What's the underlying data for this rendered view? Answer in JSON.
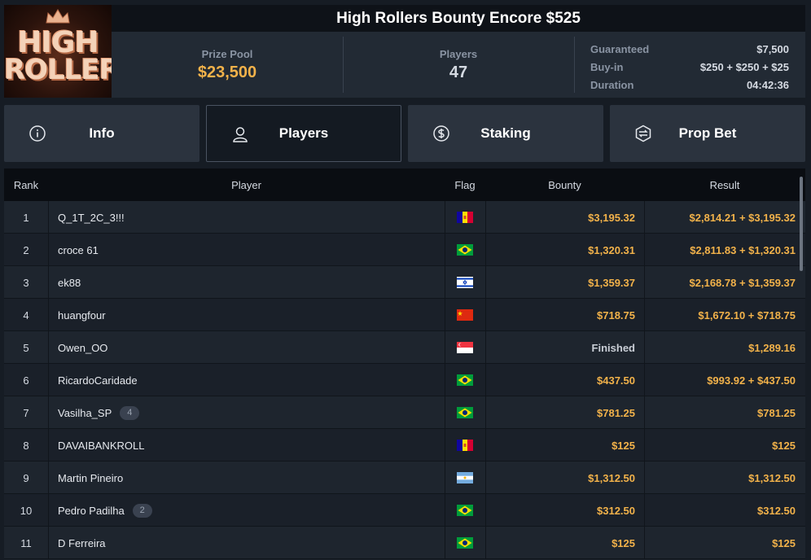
{
  "logo": {
    "line1": "HIGH",
    "line2": "ROLLERS"
  },
  "header": {
    "title": "High Rollers Bounty Encore $525"
  },
  "stats": {
    "prize_pool_label": "Prize Pool",
    "prize_pool_value": "$23,500",
    "players_label": "Players",
    "players_value": "47",
    "guaranteed_label": "Guaranteed",
    "guaranteed_value": "$7,500",
    "buyin_label": "Buy-in",
    "buyin_value": "$250 + $250 + $25",
    "duration_label": "Duration",
    "duration_value": "04:42:36"
  },
  "tabs": [
    {
      "label": "Info",
      "icon": "info-icon"
    },
    {
      "label": "Players",
      "icon": "user-icon",
      "active": true
    },
    {
      "label": "Staking",
      "icon": "dollar-coin-icon"
    },
    {
      "label": "Prop Bet",
      "icon": "prop-bet-icon"
    }
  ],
  "table": {
    "headers": {
      "rank": "Rank",
      "player": "Player",
      "flag": "Flag",
      "bounty": "Bounty",
      "result": "Result"
    },
    "rows": [
      {
        "rank": "1",
        "player": "Q_1T_2C_3!!!",
        "flag": "andorra",
        "bounty": "$3,195.32",
        "result": "$2,814.21 + $3,195.32"
      },
      {
        "rank": "2",
        "player": "croce 61",
        "flag": "brazil",
        "bounty": "$1,320.31",
        "result": "$2,811.83 + $1,320.31"
      },
      {
        "rank": "3",
        "player": "ek88",
        "flag": "israel",
        "bounty": "$1,359.37",
        "result": "$2,168.78 + $1,359.37"
      },
      {
        "rank": "4",
        "player": "huangfour",
        "flag": "china",
        "bounty": "$718.75",
        "result": "$1,672.10 + $718.75"
      },
      {
        "rank": "5",
        "player": "Owen_OO",
        "flag": "singapore",
        "bounty": "Finished",
        "result": "$1,289.16"
      },
      {
        "rank": "6",
        "player": "RicardoCaridade",
        "flag": "brazil",
        "bounty": "$437.50",
        "result": "$993.92 + $437.50"
      },
      {
        "rank": "7",
        "player": "Vasilha_SP",
        "badge": "4",
        "flag": "brazil",
        "bounty": "$781.25",
        "result": "$781.25"
      },
      {
        "rank": "8",
        "player": "DAVAIBANKROLL",
        "flag": "andorra",
        "bounty": "$125",
        "result": "$125"
      },
      {
        "rank": "9",
        "player": "Martin Pineiro",
        "flag": "argentina",
        "bounty": "$1,312.50",
        "result": "$1,312.50"
      },
      {
        "rank": "10",
        "player": "Pedro Padilha",
        "badge": "2",
        "flag": "brazil",
        "bounty": "$312.50",
        "result": "$312.50"
      },
      {
        "rank": "11",
        "player": "D Ferreira",
        "flag": "brazil",
        "bounty": "$125",
        "result": "$125"
      }
    ]
  },
  "colors": {
    "accent_gold": "#f2b24a",
    "header_bg": "#0e1218",
    "stats_bg": "#222a34",
    "tab_bg": "#2b333e"
  }
}
